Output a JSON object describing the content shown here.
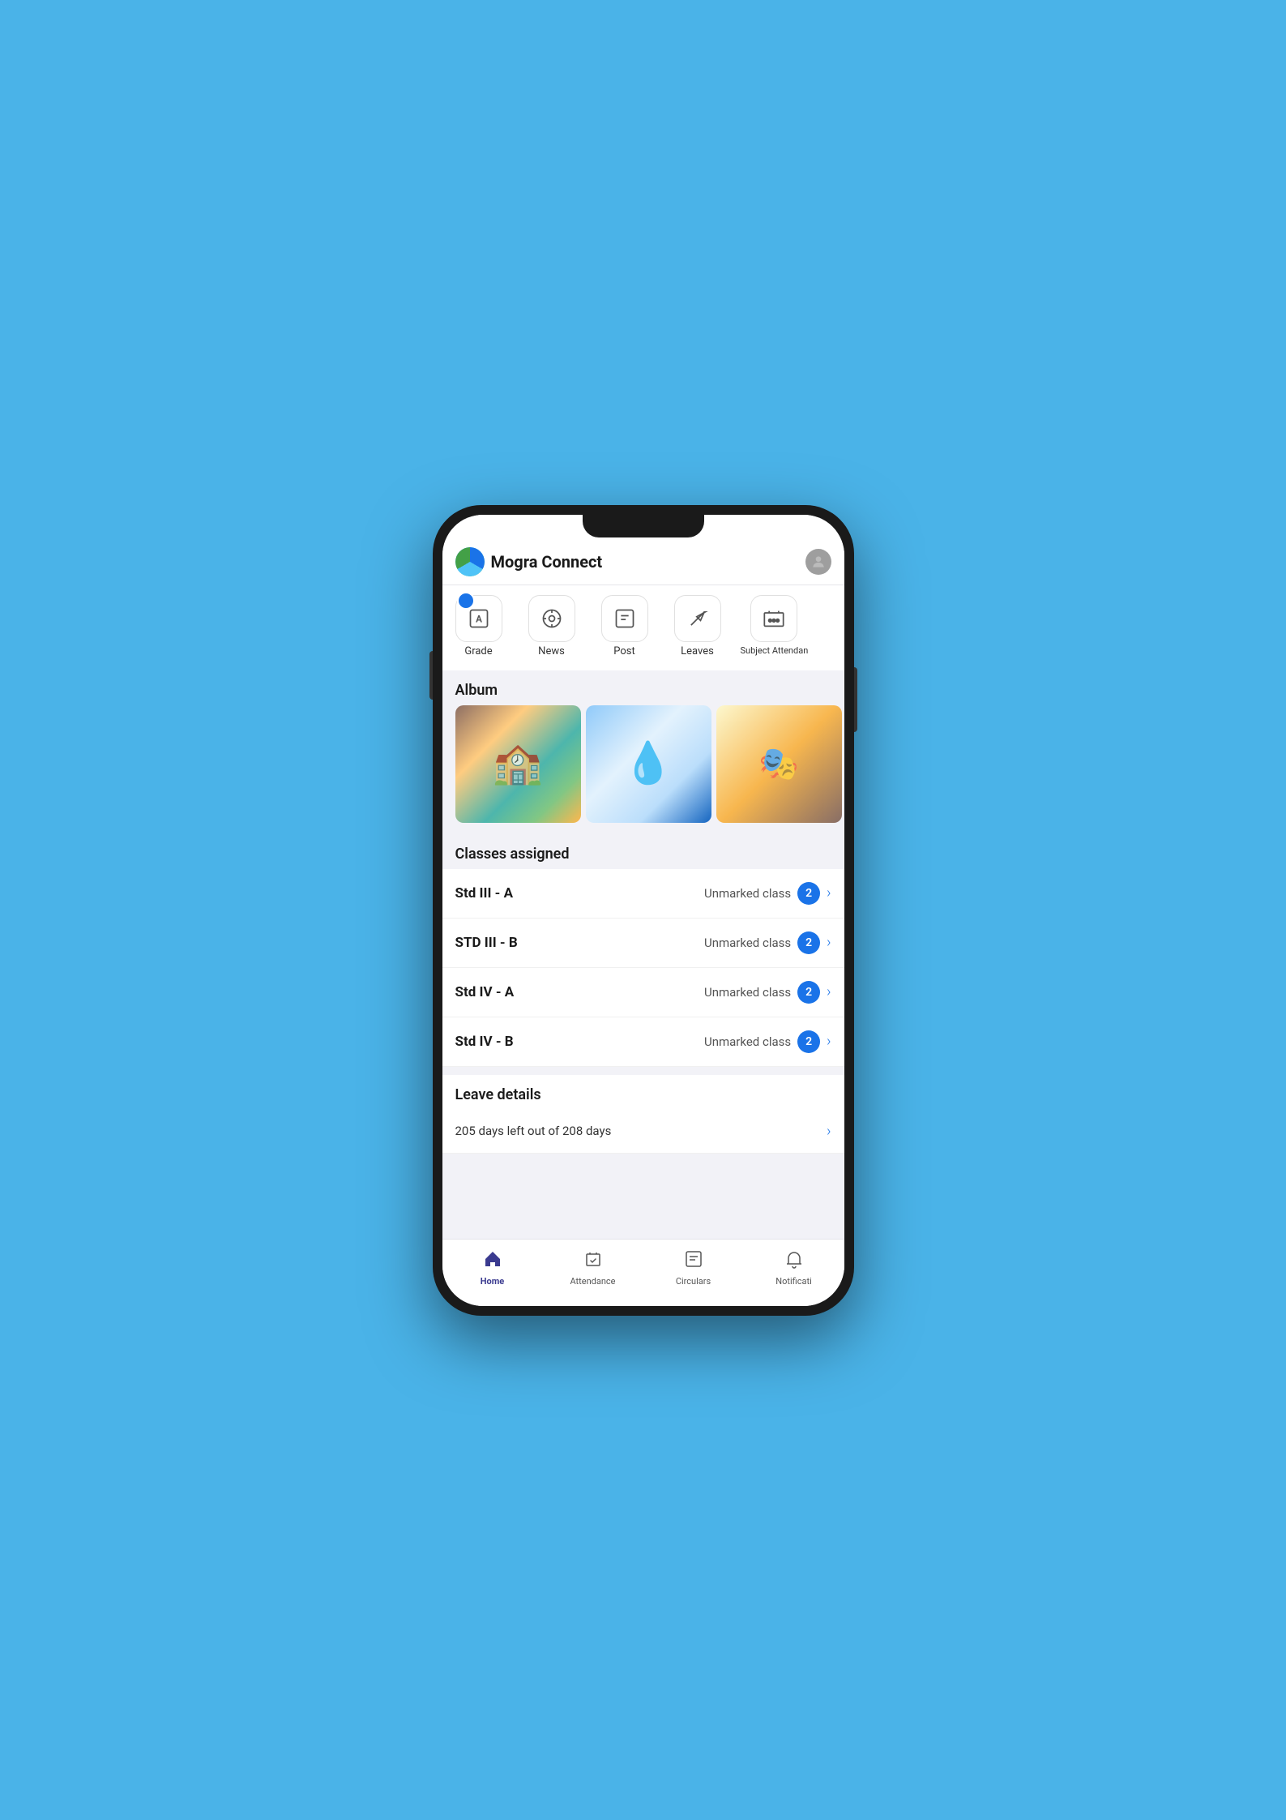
{
  "app": {
    "title": "Mogra Connect"
  },
  "quick_actions": [
    {
      "id": "grade",
      "label": "Grade",
      "icon": "grade"
    },
    {
      "id": "news",
      "label": "News",
      "icon": "news"
    },
    {
      "id": "post",
      "label": "Post",
      "icon": "post"
    },
    {
      "id": "leaves",
      "label": "Leaves",
      "icon": "leaves"
    },
    {
      "id": "subject_attendance",
      "label": "Subject Attendan",
      "icon": "subject_attendance"
    }
  ],
  "album": {
    "title": "Album",
    "images": [
      {
        "id": 1,
        "alt": "Classroom scene"
      },
      {
        "id": 2,
        "alt": "Save water performance"
      },
      {
        "id": 3,
        "alt": "Character costume"
      }
    ]
  },
  "classes": {
    "title": "Classes assigned",
    "items": [
      {
        "name": "Std III - A",
        "status": "Unmarked class",
        "count": 2
      },
      {
        "name": "STD III - B",
        "status": "Unmarked class",
        "count": 2
      },
      {
        "name": "Std IV - A",
        "status": "Unmarked class",
        "count": 2
      },
      {
        "name": "Std IV - B",
        "status": "Unmarked class",
        "count": 2
      }
    ]
  },
  "leave_details": {
    "title": "Leave details",
    "text": "205 days left out of 208 days"
  },
  "bottom_nav": [
    {
      "id": "home",
      "label": "Home",
      "icon": "home",
      "active": true
    },
    {
      "id": "attendance",
      "label": "Attendance",
      "icon": "attendance",
      "active": false
    },
    {
      "id": "circulars",
      "label": "Circulars",
      "icon": "circulars",
      "active": false
    },
    {
      "id": "notifications",
      "label": "Notificati",
      "icon": "notifications",
      "active": false
    }
  ]
}
